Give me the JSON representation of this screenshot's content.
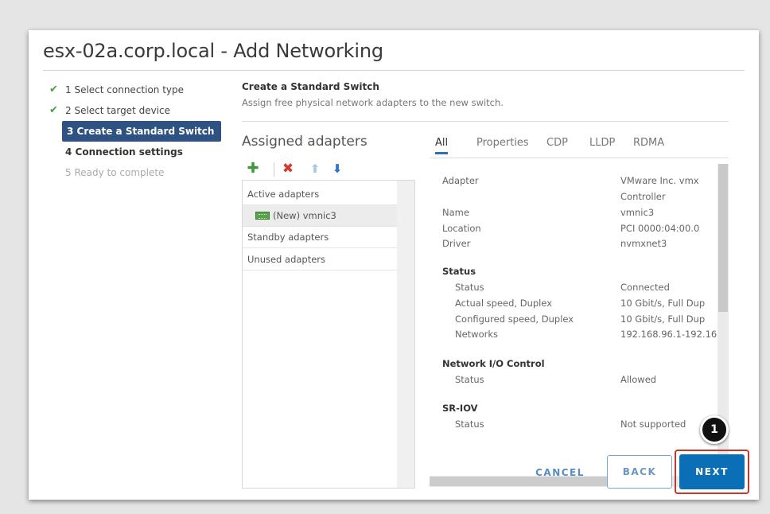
{
  "dialog": {
    "title": "esx-02a.corp.local - Add Networking"
  },
  "steps": [
    {
      "label": "1 Select connection type",
      "state": "done"
    },
    {
      "label": "2 Select target device",
      "state": "done"
    },
    {
      "label": "3 Create a Standard Switch",
      "state": "active"
    },
    {
      "label": "4 Connection settings",
      "state": "pending"
    },
    {
      "label": "5 Ready to complete",
      "state": "disabled"
    }
  ],
  "section": {
    "title": "Create a Standard Switch",
    "subtitle": "Assign free physical network adapters to the new switch."
  },
  "adapters": {
    "title": "Assigned adapters",
    "toolbar": [
      "add-icon",
      "remove-icon",
      "move-up-icon",
      "move-down-icon"
    ],
    "groups": {
      "active": "Active adapters",
      "active_item": "(New) vmnic3",
      "standby": "Standby adapters",
      "unused": "Unused adapters"
    }
  },
  "tabs": [
    "All",
    "Properties",
    "CDP",
    "LLDP",
    "RDMA"
  ],
  "properties": {
    "adapter_label": "Adapter",
    "adapter_value_1": "VMware Inc. vmx",
    "adapter_value_2": "Controller",
    "name_label": "Name",
    "name_value": "vmnic3",
    "location_label": "Location",
    "location_value": "PCI 0000:04:00.0",
    "driver_label": "Driver",
    "driver_value": "nvmxnet3",
    "status_heading": "Status",
    "status_label": "Status",
    "status_value": "Connected",
    "actual_speed_label": "Actual speed, Duplex",
    "actual_speed_value": "10 Gbit/s, Full Dup",
    "configured_speed_label": "Configured speed, Duplex",
    "configured_speed_value": "10 Gbit/s, Full Dup",
    "networks_label": "Networks",
    "networks_value": "192.168.96.1-192.16",
    "nioc_heading": "Network I/O Control",
    "nioc_status_label": "Status",
    "nioc_status_value": "Allowed",
    "sriov_heading": "SR-IOV",
    "sriov_status_label": "Status",
    "sriov_status_value": "Not supported"
  },
  "footer": {
    "cancel": "CANCEL",
    "back": "BACK",
    "next": "NEXT",
    "callout": "1"
  },
  "colors": {
    "accent": "#0b6fb8",
    "active_step": "#2e5382",
    "check": "#4a9d3f",
    "highlight_frame": "#c0392b"
  }
}
